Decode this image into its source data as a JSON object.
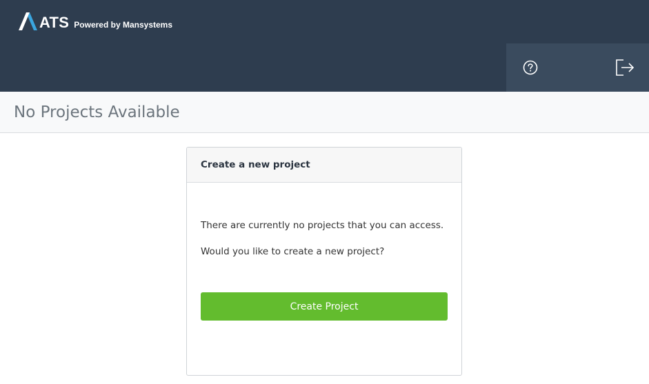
{
  "brand": {
    "name": "ATS",
    "tagline": "Powered by Mansystems"
  },
  "header": {
    "actions": [
      {
        "icon": "help-icon"
      },
      {
        "icon": "logout-icon"
      }
    ]
  },
  "page": {
    "title": "No Projects Available"
  },
  "card": {
    "title": "Create a new project",
    "message": "There are currently no projects that you can access.",
    "question": "Would you like to create a new project?",
    "button_label": "Create Project"
  },
  "colors": {
    "header_bg": "#2e3d4f",
    "header_actions_bg": "#3a4b5e",
    "button_green": "#63bc2e",
    "title_gray": "#6c757d"
  }
}
